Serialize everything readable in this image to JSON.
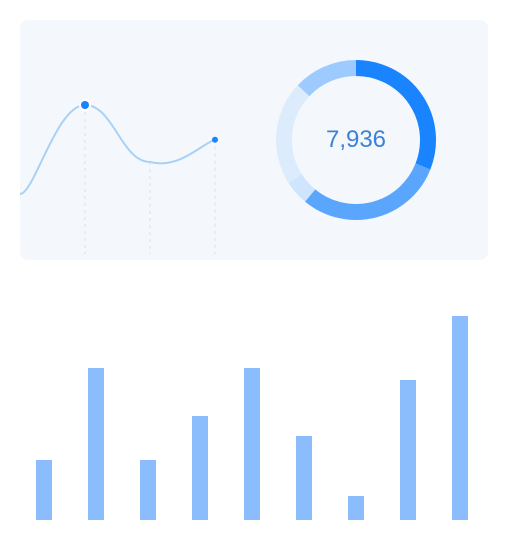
{
  "colors": {
    "card_background": "#f4f8fd",
    "line_color": "#a9d1f5",
    "point_color": "#1a84ff",
    "bar_color": "#8bbcfb",
    "donut_segments": [
      "#1a84ff",
      "#5ba6fd",
      "#cfe4fd",
      "#dcecfd",
      "#9ecbff"
    ],
    "label_color": "#3b82d6"
  },
  "chart_data": [
    {
      "type": "line",
      "title": "",
      "xlabel": "",
      "ylabel": "",
      "smooth": true,
      "grid": false,
      "points": [
        {
          "x": 0,
          "y": 0.0
        },
        {
          "x": 1,
          "y": 1.0
        },
        {
          "x": 2,
          "y": 0.36
        },
        {
          "x": 3,
          "y": 0.61
        }
      ],
      "highlighted_points": [
        1,
        3
      ],
      "guide_lines_at_x": [
        1,
        2,
        3
      ]
    },
    {
      "type": "pie",
      "style": "donut",
      "center_label": "7,936",
      "slices": [
        {
          "value": 31
        },
        {
          "value": 30
        },
        {
          "value": 5
        },
        {
          "value": 21
        },
        {
          "value": 13
        }
      ]
    },
    {
      "type": "bar",
      "title": "",
      "xlabel": "",
      "ylabel": "",
      "categories": [
        "",
        "",
        "",
        "",
        "",
        "",
        "",
        "",
        ""
      ],
      "values": [
        30,
        76,
        30,
        52,
        76,
        42,
        12,
        70,
        102
      ],
      "ylim": [
        0,
        102
      ]
    }
  ]
}
